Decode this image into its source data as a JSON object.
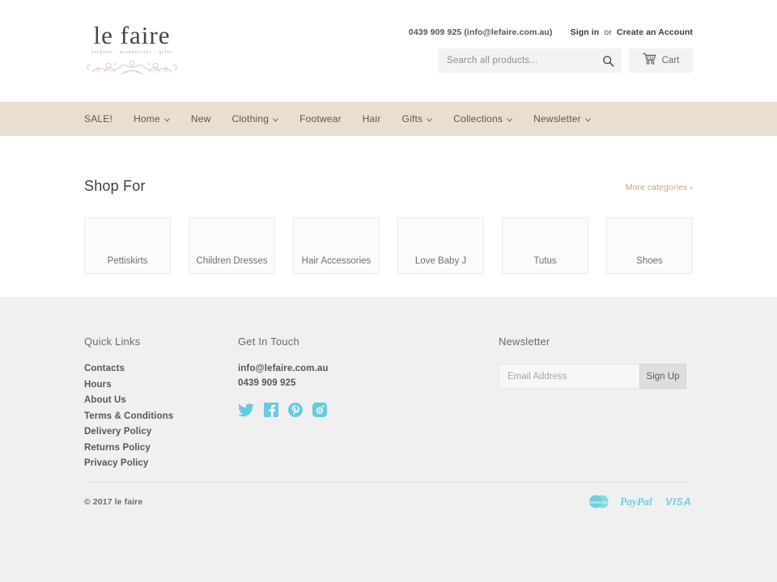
{
  "header": {
    "logo": {
      "word": "le faire",
      "tagline": "fashion · accessories · gifts"
    },
    "topbar": {
      "phone_email": "0439 909 925 (info@lefaire.com.au)",
      "sign_in": "Sign in",
      "or": "or",
      "create_account": "Create an Account"
    },
    "search": {
      "placeholder": "Search all products...",
      "icon": "search-icon"
    },
    "cart": {
      "label": "Cart",
      "icon": "shopping-cart-icon"
    }
  },
  "nav": {
    "background": "#e8dfd0",
    "items": [
      {
        "label": "SALE!",
        "has_dropdown": false
      },
      {
        "label": "Home",
        "has_dropdown": true
      },
      {
        "label": "New",
        "has_dropdown": false
      },
      {
        "label": "Clothing",
        "has_dropdown": true
      },
      {
        "label": "Footwear",
        "has_dropdown": false
      },
      {
        "label": "Hair",
        "has_dropdown": false
      },
      {
        "label": "Gifts",
        "has_dropdown": true
      },
      {
        "label": "Collections",
        "has_dropdown": true
      },
      {
        "label": "Newsletter",
        "has_dropdown": true
      }
    ]
  },
  "shop_for": {
    "title": "Shop For",
    "more_link": "More categories ›",
    "more_link_color": "#c2a477",
    "categories": [
      {
        "label": "Pettiskirts"
      },
      {
        "label": "Children Dresses"
      },
      {
        "label": "Hair Accessories"
      },
      {
        "label": "Love Baby J"
      },
      {
        "label": "Tutus"
      },
      {
        "label": "Shoes"
      }
    ]
  },
  "footer": {
    "quick_links": {
      "title": "Quick Links",
      "items": [
        "Contacts",
        "Hours",
        "About Us",
        "Terms & Conditions",
        "Delivery Policy",
        "Returns Policy",
        "Privacy Policy"
      ]
    },
    "get_in_touch": {
      "title": "Get In Touch",
      "email": "info@lefaire.com.au",
      "phone": "0439 909 925",
      "social_color": "#64cbe0",
      "socials": [
        "twitter-icon",
        "facebook-icon",
        "pinterest-icon",
        "instagram-icon"
      ]
    },
    "newsletter": {
      "title": "Newsletter",
      "placeholder": "Email Address",
      "button": "Sign Up"
    },
    "copyright": "© 2017 le faire",
    "payment_color": "#6fcfe0",
    "payments": [
      "mastercard-icon",
      "paypal-icon",
      "visa-icon"
    ]
  }
}
